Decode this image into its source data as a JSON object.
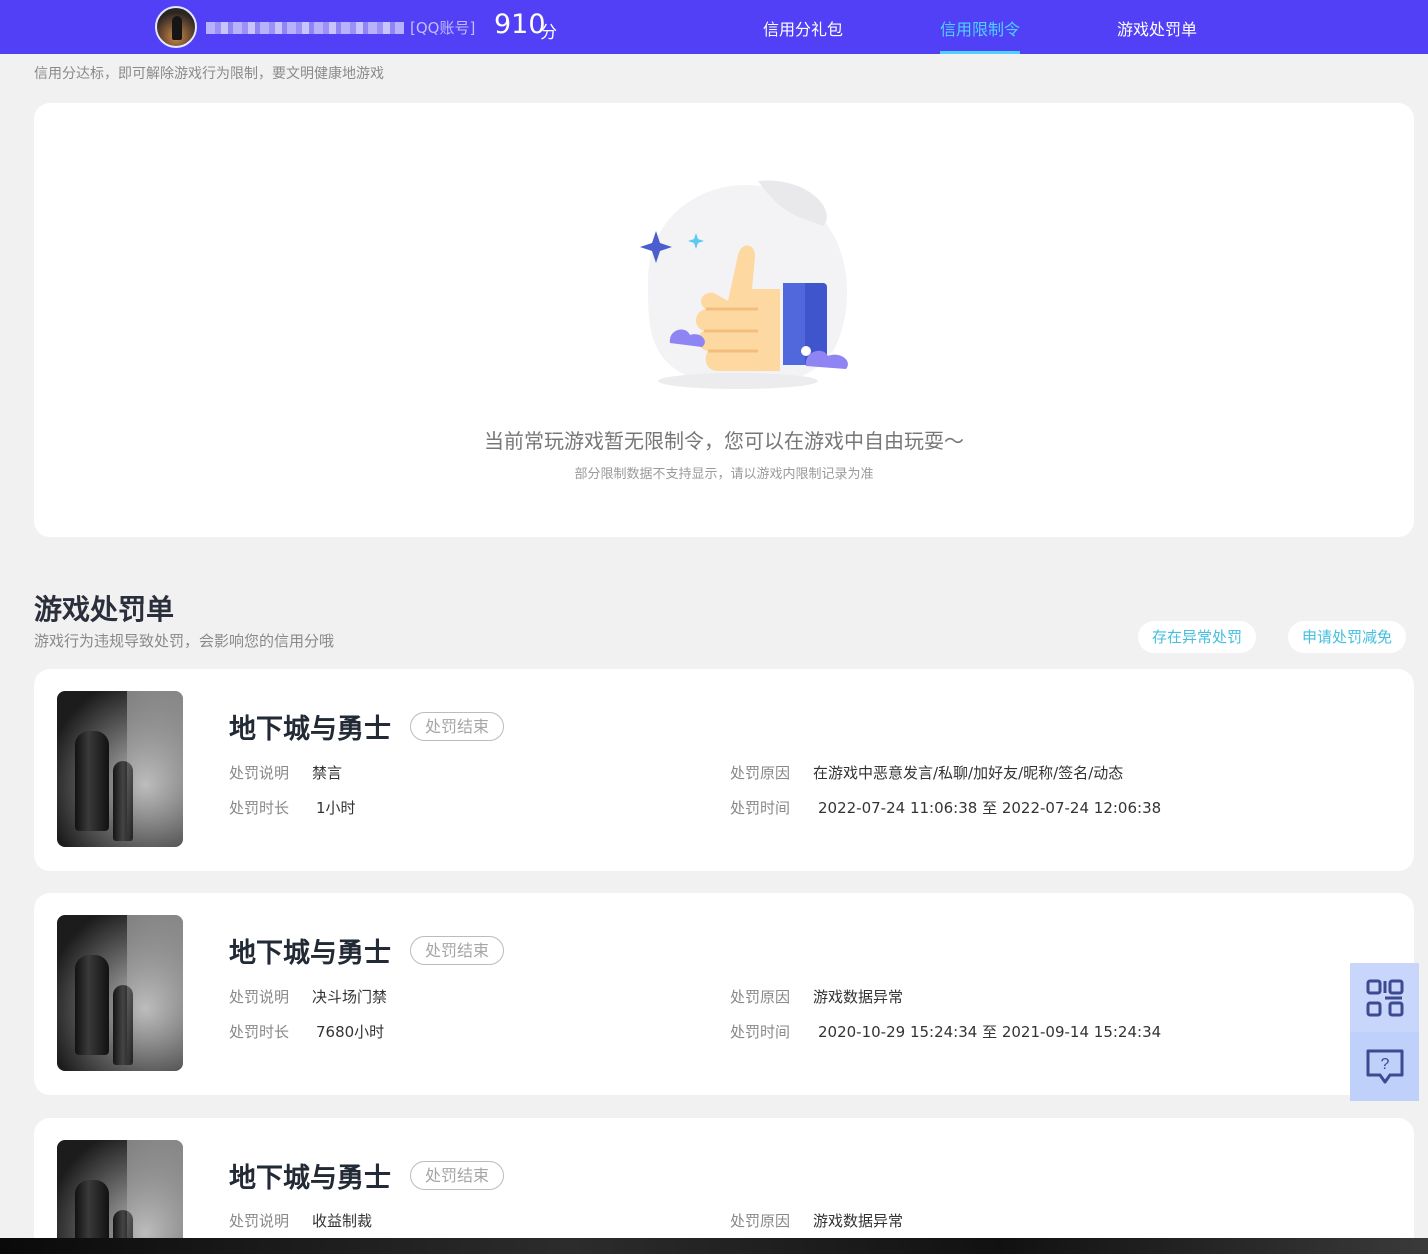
{
  "header": {
    "account_tag": "[QQ账号]",
    "score": "910",
    "score_unit": "分",
    "tabs": [
      {
        "label": "信用分礼包",
        "active": false
      },
      {
        "label": "信用限制令",
        "active": true
      },
      {
        "label": "游戏处罚单",
        "active": false
      }
    ]
  },
  "tip": "信用分达标，即可解除游戏行为限制，要文明健康地游戏",
  "restriction": {
    "empty_title": "当前常玩游戏暂无限制令，您可以在游戏中自由玩耍～",
    "empty_sub": "部分限制数据不支持显示，请以游戏内限制记录为准"
  },
  "penalty_section": {
    "title": "游戏处罚单",
    "subtitle": "游戏行为违规导致处罚，会影响您的信用分哦",
    "btn_abnormal": "存在异常处罚",
    "btn_reduce": "申请处罚减免",
    "labels": {
      "desc": "处罚说明",
      "duration": "处罚时长",
      "reason": "处罚原因",
      "time": "处罚时间"
    },
    "items": [
      {
        "game": "地下城与勇士",
        "status": "处罚结束",
        "desc": "禁言",
        "duration": "1小时",
        "reason": "在游戏中恶意发言/私聊/加好友/昵称/签名/动态",
        "time": "2022-07-24 11:06:38 至 2022-07-24 12:06:38"
      },
      {
        "game": "地下城与勇士",
        "status": "处罚结束",
        "desc": "决斗场门禁",
        "duration": "7680小时",
        "reason": "游戏数据异常",
        "time": "2020-10-29 15:24:34 至 2021-09-14 15:24:34"
      },
      {
        "game": "地下城与勇士",
        "status": "处罚结束",
        "desc": "收益制裁",
        "reason": "游戏数据异常"
      }
    ]
  },
  "icons": {
    "qr": "qr-code-icon",
    "help": "help-chat-icon"
  },
  "colors": {
    "header_bg": "#5140f5",
    "active_tab": "#4fd2ff",
    "pill_text": "#43bfe0"
  }
}
